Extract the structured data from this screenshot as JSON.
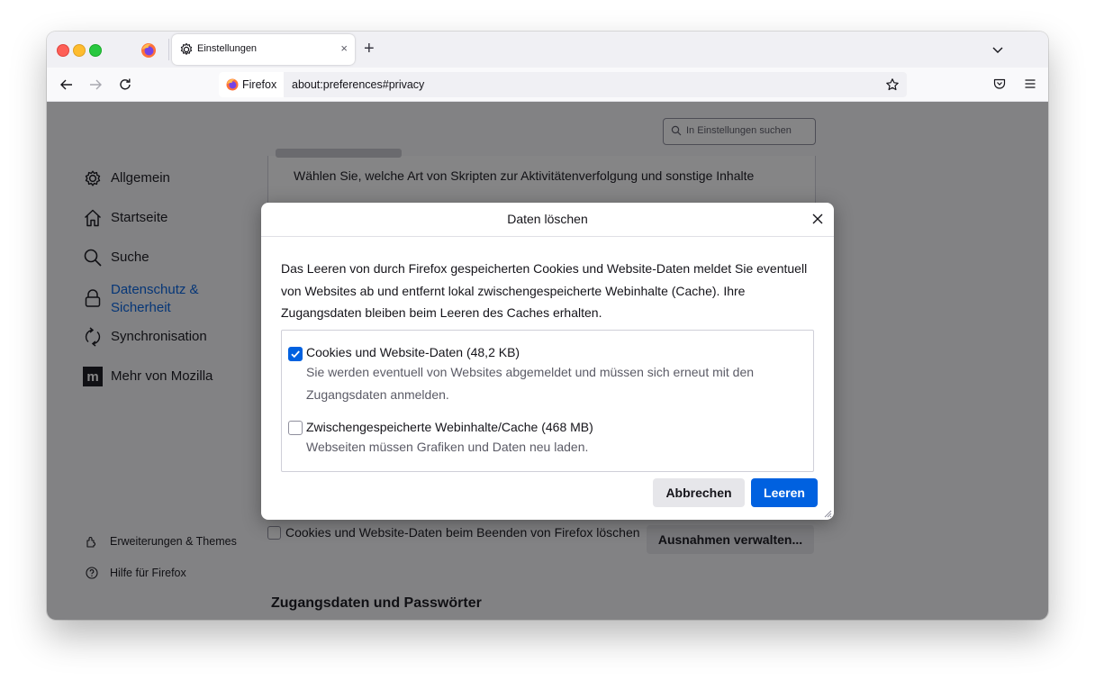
{
  "browser": {
    "tab": {
      "title": "Einstellungen",
      "close_glyph": "×"
    },
    "new_tab_glyph": "+",
    "identity_label": "Firefox",
    "url": "about:preferences#privacy"
  },
  "settings": {
    "search_placeholder": "In Einstellungen suchen",
    "sidebar": {
      "items": [
        {
          "label": "Allgemein",
          "icon": "gear-icon"
        },
        {
          "label": "Startseite",
          "icon": "home-icon"
        },
        {
          "label": "Suche",
          "icon": "search-icon"
        },
        {
          "label": "Datenschutz & Sicherheit",
          "icon": "lock-icon",
          "active": true
        },
        {
          "label": "Synchronisation",
          "icon": "sync-icon"
        },
        {
          "label": "Mehr von Mozilla",
          "icon": "mozilla-icon"
        }
      ],
      "footer": [
        {
          "label": "Erweiterungen & Themes",
          "icon": "extensions-icon"
        },
        {
          "label": "Hilfe für Firefox",
          "icon": "help-icon"
        }
      ]
    },
    "tracking_text": "Wählen Sie, welche Art von Skripten zur Aktivitätenverfolgung und sonstige Inhalte",
    "delete_on_close_label": "Cookies und Website-Daten beim Beenden von Firefox löschen",
    "manage_exceptions_label": "Ausnahmen verwalten...",
    "passwords_heading": "Zugangsdaten und Passwörter"
  },
  "dialog": {
    "title": "Daten löschen",
    "description": "Das Leeren von durch Firefox gespeicherten Cookies und Website-Daten meldet Sie eventuell von Websites ab und entfernt lokal zwischengespeicherte Webinhalte (Cache). Ihre Zugangsdaten bleiben beim Leeren des Caches erhalten.",
    "options": [
      {
        "label": "Cookies und Website-Daten (48,2 KB)",
        "description": "Sie werden eventuell von Websites abgemeldet und müssen sich erneut mit den Zugangsdaten anmelden.",
        "checked": true
      },
      {
        "label": "Zwischengespeicherte Webinhalte/Cache (468 MB)",
        "description": "Webseiten müssen Grafiken und Daten neu laden.",
        "checked": false
      }
    ],
    "cancel_label": "Abbrechen",
    "clear_label": "Leeren"
  },
  "colors": {
    "accent": "#0061e0",
    "overlay": "rgba(12,12,13,0.5)"
  }
}
